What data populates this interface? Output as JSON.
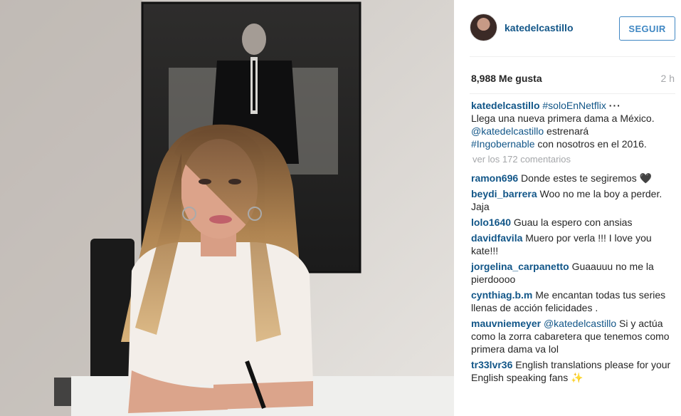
{
  "post": {
    "username": "katedelcastillo",
    "follow_label": "SEGUIR",
    "likes": "8,988 Me gusta",
    "time": "2 h"
  },
  "caption": {
    "user": "katedelcastillo",
    "hashtag1": "#soloEnNetflix",
    "ellipsis": "···",
    "line1": "Llega una nueva primera dama a México.",
    "mention": "@katedelcastillo",
    "text2": " estrenará",
    "hashtag2": "#Ingobernable",
    "text3": " con nosotros en el 2016."
  },
  "view_all": "ver los 172 comentarios",
  "comments": [
    {
      "user": "ramon696",
      "text": "Donde estes te segiremos 🖤"
    },
    {
      "user": "beydi_barrera",
      "text": "Woo no me la boy a perder. Jaja"
    },
    {
      "user": "lolo1640",
      "text": "Guau la espero con ansias"
    },
    {
      "user": "davidfavila",
      "text": "Muero por verla !!! I love you kate!!!"
    },
    {
      "user": "jorgelina_carpanetto",
      "text": "Guaauuu no me la pierdoooo"
    },
    {
      "user": "cynthiag.b.m",
      "text": "Me encantan todas tus series llenas de acción felicidades ."
    },
    {
      "user": "mauvniemeyer",
      "mention": "@katedelcastillo",
      "text": " Si y actúa como la zorra cabaretera que tenemos como primera dama va lol"
    },
    {
      "user": "tr33lvr36",
      "text": "English translations please for your English speaking fans ✨"
    }
  ]
}
